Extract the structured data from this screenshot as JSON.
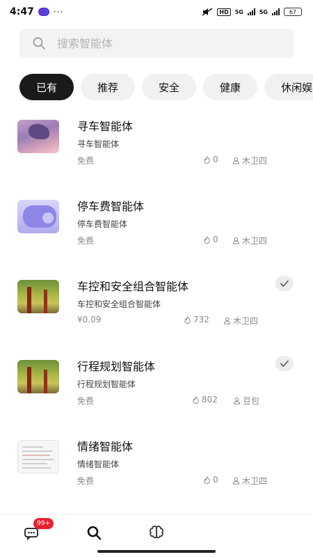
{
  "status_bar": {
    "time": "4:47",
    "dots": "···",
    "hd": "HD",
    "net1": "5G",
    "net2": "5G",
    "battery": "67"
  },
  "search": {
    "placeholder": "搜索智能体"
  },
  "chips": [
    "已有",
    "推荐",
    "安全",
    "健康",
    "休闲娱"
  ],
  "agents": [
    {
      "title": "寻车智能体",
      "subtitle": "寻车智能体",
      "price": "免费",
      "uses": "0",
      "author": "木卫四",
      "added": false,
      "thumb": "purple-figure"
    },
    {
      "title": "停车费智能体",
      "subtitle": "停车费智能体",
      "price": "免费",
      "uses": "0",
      "author": "木卫四",
      "added": false,
      "thumb": "lavender-shape"
    },
    {
      "title": "车控和安全组合智能体",
      "subtitle": "车控和安全组合智能体",
      "price": "¥0.09",
      "uses": "732",
      "author": "木卫四",
      "added": true,
      "thumb": "autumn-trees"
    },
    {
      "title": "行程规划智能体",
      "subtitle": "行程规划智能体",
      "price": "免费",
      "uses": "802",
      "author": "豆包",
      "added": true,
      "thumb": "autumn-trees"
    },
    {
      "title": "情绪智能体",
      "subtitle": "情绪智能体",
      "price": "免费",
      "uses": "0",
      "author": "木卫四",
      "added": false,
      "thumb": "document-page"
    }
  ],
  "bottom_nav": {
    "messages_badge": "99+",
    "items": [
      "chat-icon",
      "search-icon",
      "brain-icon"
    ]
  },
  "colors": {
    "active_chip": "#1a1a1a",
    "chip_bg": "#f1f1f3",
    "badge": "#e8212f"
  }
}
